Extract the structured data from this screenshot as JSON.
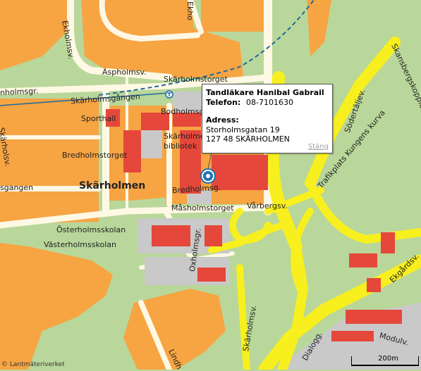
{
  "map": {
    "colors": {
      "green": "#b9d79a",
      "orange": "#f7a443",
      "road": "#fff8e4",
      "building": "#e5473b",
      "yellow": "#f8ef1e",
      "grey": "#c9c9c9"
    },
    "labels": {
      "ekholmsv_top": "Ekho",
      "ekholmsv": "Ekholmsv.",
      "aspholmsv": "Äspholmsv.",
      "skarholmstorget": "Skärholmstorget",
      "holmsgr": "nholmsgr.",
      "skarholmsgangen": "Skärholmsgången",
      "bodholmsgr": "Bodholmsgr.",
      "sporthall": "Sporthall",
      "bibliotek_1": "Skärholmens",
      "bibliotek_2": "bibliotek",
      "bredholmstorget": "Bredholmstorget",
      "skarholmen": "Skärholmen",
      "gangen": "sgangen",
      "bredholmsg": "Bredholmsg.",
      "masholmstorget": "Måsholmstorget",
      "varbergsv": "Vårbergsv.",
      "osterholmsskolan": "Österholmsskolan",
      "vasterholmsskolan": "Västerholmsskolan",
      "oxholmsgr": "Oxholmsgr.",
      "skarholmsv": "Skärholmsv.",
      "dialogg": "Dialogg.",
      "modulv": "Modulv.",
      "ekgardsv": "Ekgårdsv.",
      "trafikplats": "Trafikplats Kungens kurva",
      "sodertaljev": "Södertäljev.",
      "kansberg": "Skansbergskopplet",
      "lindh": "Lindh",
      "left_road": "Skärholsv."
    },
    "scale_label": "200m",
    "credit": "© Lantmäteriverket"
  },
  "popup": {
    "title": "Tandläkare Hanibal Gabrail",
    "phone_label": "Telefon:",
    "phone": "08-7101630",
    "address_label": "Adress:",
    "street": "Storholmsgatan 19",
    "postal": "127 48 SKÄRHOLMEN",
    "close": "Stäng"
  }
}
